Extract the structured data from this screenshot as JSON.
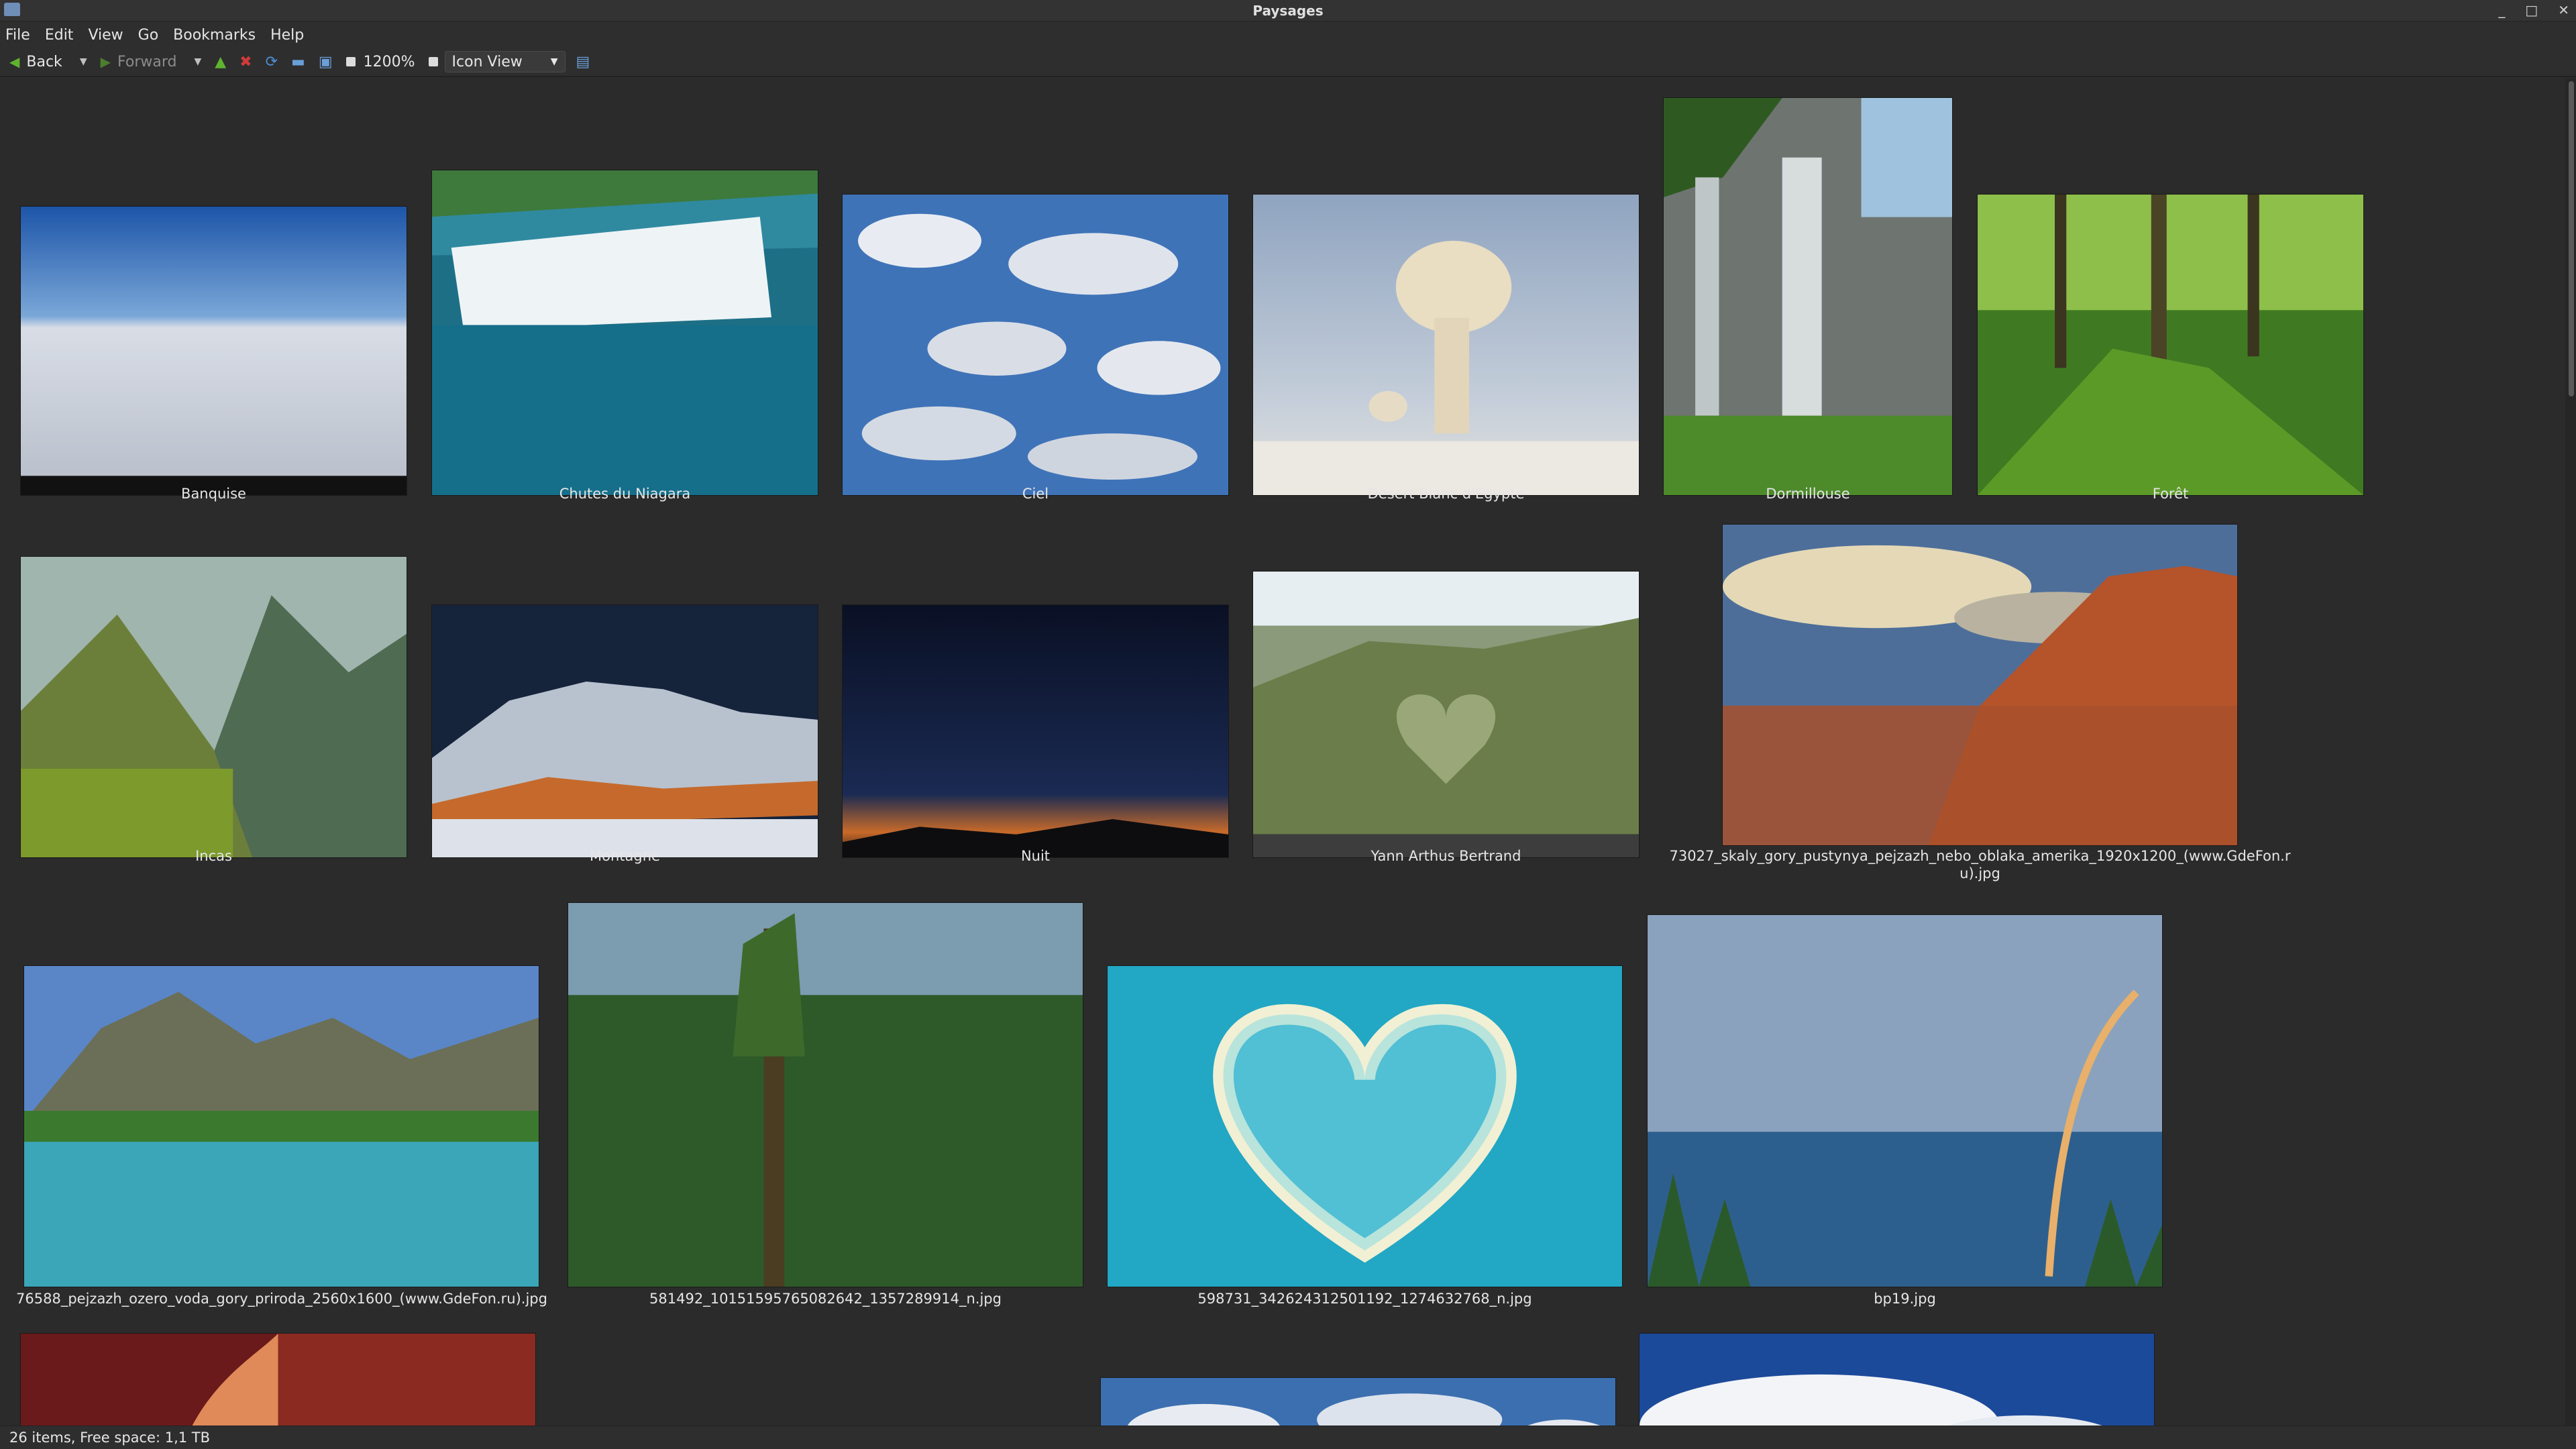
{
  "window": {
    "title": "Paysages",
    "controls": [
      "_",
      "□",
      "✕"
    ]
  },
  "menu": [
    "File",
    "Edit",
    "View",
    "Go",
    "Bookmarks",
    "Help"
  ],
  "toolbar": {
    "back": "Back",
    "forward": "Forward",
    "zoom": "1200%",
    "view_mode": "Icon View"
  },
  "items": [
    {
      "name": "Banquise"
    },
    {
      "name": "Chutes du Niagara"
    },
    {
      "name": "Ciel"
    },
    {
      "name": "Désert Blanc d'Égypte"
    },
    {
      "name": "Dormillouse"
    },
    {
      "name": "Forêt"
    },
    {
      "name": "Incas"
    },
    {
      "name": "Montagne"
    },
    {
      "name": "Nuit"
    },
    {
      "name": "Yann Arthus Bertrand"
    },
    {
      "name": "73027_skaly_gory_pustynya_pejzazh_nebo_oblaka_amerika_1920x1200_(www.GdeFon.ru).jpg"
    },
    {
      "name": "76588_pejzazh_ozero_voda_gory_priroda_2560x1600_(www.GdeFon.ru).jpg"
    },
    {
      "name": "581492_10151595765082642_1357289914_n.jpg"
    },
    {
      "name": "598731_342624312501192_1274632768_n.jpg"
    },
    {
      "name": "bp19.jpg"
    },
    {
      "name": ""
    },
    {
      "name": ""
    },
    {
      "name": ""
    }
  ],
  "status": "26 items, Free space: 1,1  TB"
}
